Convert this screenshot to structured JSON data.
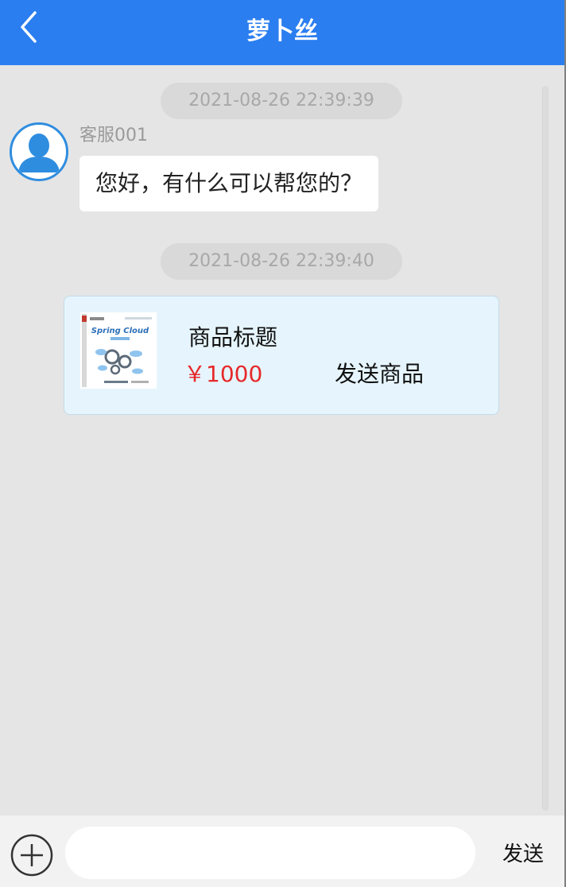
{
  "header": {
    "title": "萝卜丝",
    "back_icon": "chevron-left-icon"
  },
  "messages": [
    {
      "timestamp": "2021-08-26 22:39:39",
      "sender": "客服001",
      "text": "您好，有什么可以帮您的？"
    },
    {
      "timestamp": "2021-08-26 22:39:40",
      "product": {
        "title": "商品标题",
        "price": "￥1000",
        "action_label": "发送商品",
        "cover_title": "Spring Cloud"
      }
    }
  ],
  "input_bar": {
    "plus_icon": "plus-circle-icon",
    "placeholder": "",
    "send_label": "发送"
  },
  "colors": {
    "header_bg": "#2b7ef0",
    "chat_bg": "#e5e5e5",
    "price": "#e6292b",
    "card_bg": "#e6f5fd",
    "avatar_accent": "#2f8de0"
  }
}
